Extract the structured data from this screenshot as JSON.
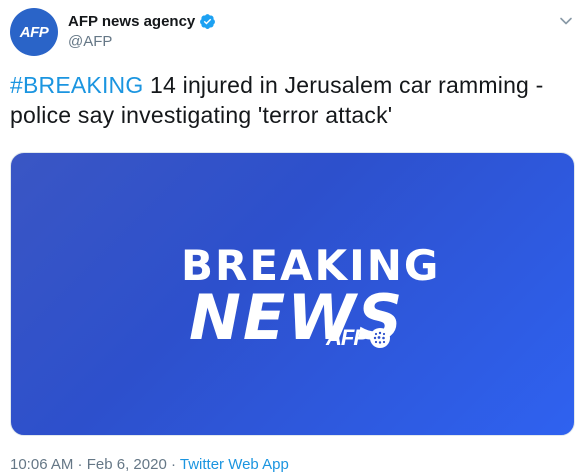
{
  "author": {
    "display_name": "AFP news agency",
    "handle": "@AFP",
    "avatar_text": "AFP"
  },
  "icons": {
    "verified": "verified-badge-icon",
    "more": "chevron-down-icon",
    "globe": "globe-dots-icon"
  },
  "colors": {
    "link": "#1b95e0",
    "avatar_bg": "#2a64c8",
    "media_bg_start": "#3a56c4",
    "media_bg_end": "#2f62f0",
    "muted": "#657786"
  },
  "tweet": {
    "hashtag": "#BREAKING",
    "body": " 14 injured in Jerusalem car ramming - police say investigating 'terror attack'"
  },
  "media": {
    "line1": "BREAKING",
    "line2": "NEWS",
    "logo": "AFP"
  },
  "meta": {
    "time": "10:06 AM",
    "sep": " · ",
    "date": "Feb 6, 2020",
    "sep2": " · ",
    "source": "Twitter Web App"
  }
}
